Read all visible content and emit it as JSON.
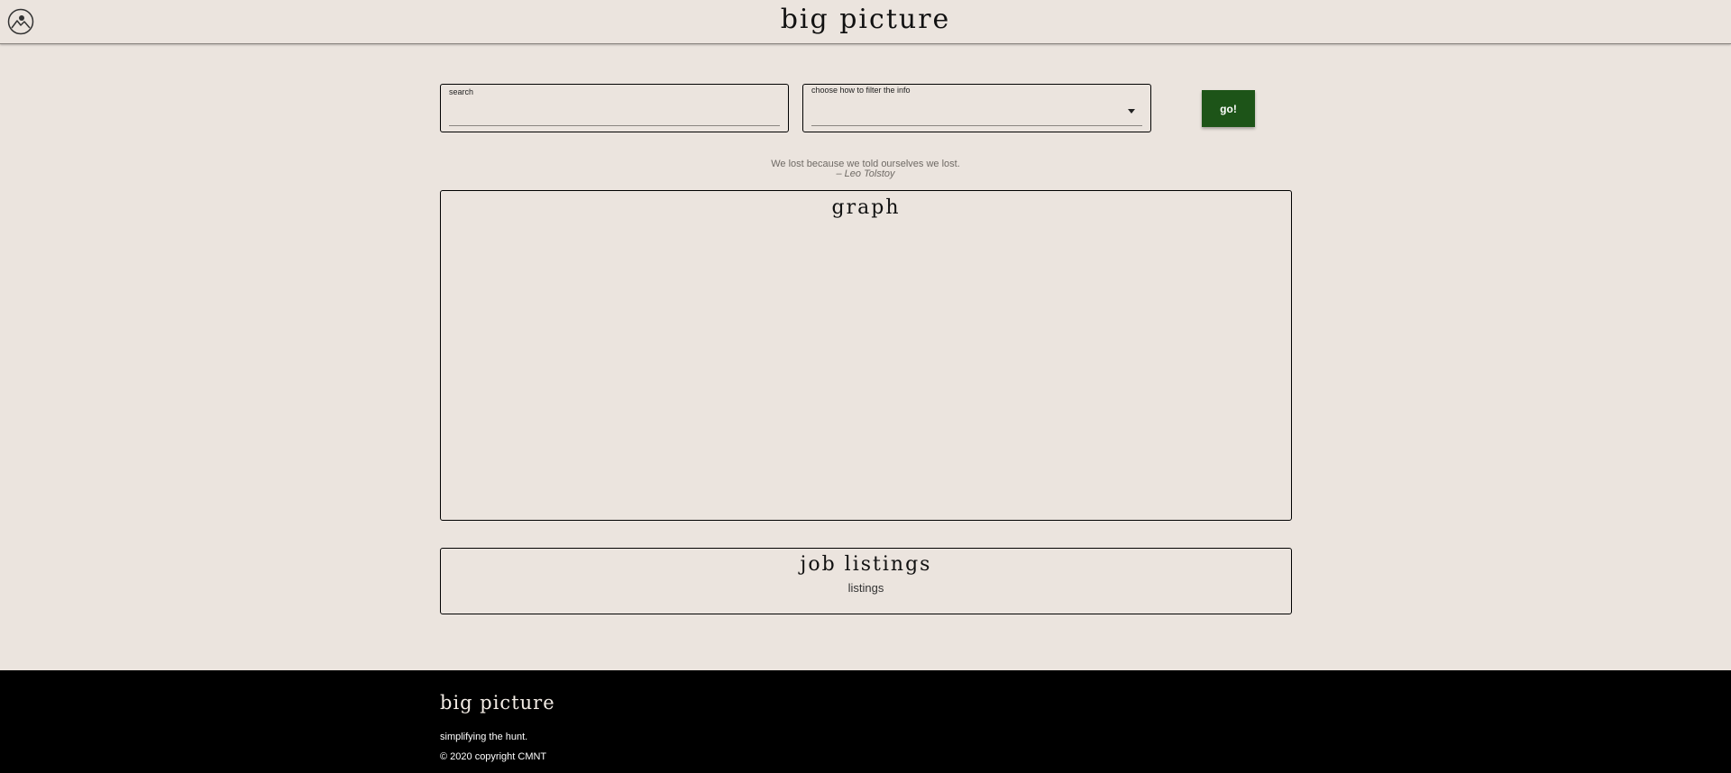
{
  "header": {
    "title": "big picture",
    "logo_icon": "mountain-avatar-icon"
  },
  "search": {
    "label": "search",
    "value": ""
  },
  "filter": {
    "label": "choose how to filter the info",
    "selected": ""
  },
  "actions": {
    "go_label": "go!"
  },
  "quote": {
    "text": "We lost because we told ourselves we lost.",
    "author": "– Leo Tolstoy"
  },
  "graph": {
    "title": "graph"
  },
  "listings": {
    "title": "job listings",
    "body": "listings"
  },
  "footer": {
    "title": "big picture",
    "tagline": "simplifying the hunt.",
    "copyright": "© 2020 copyright CMNT"
  },
  "colors": {
    "background": "#ebe4de",
    "accent_button": "#1d5418",
    "footer_bg": "#000000"
  }
}
